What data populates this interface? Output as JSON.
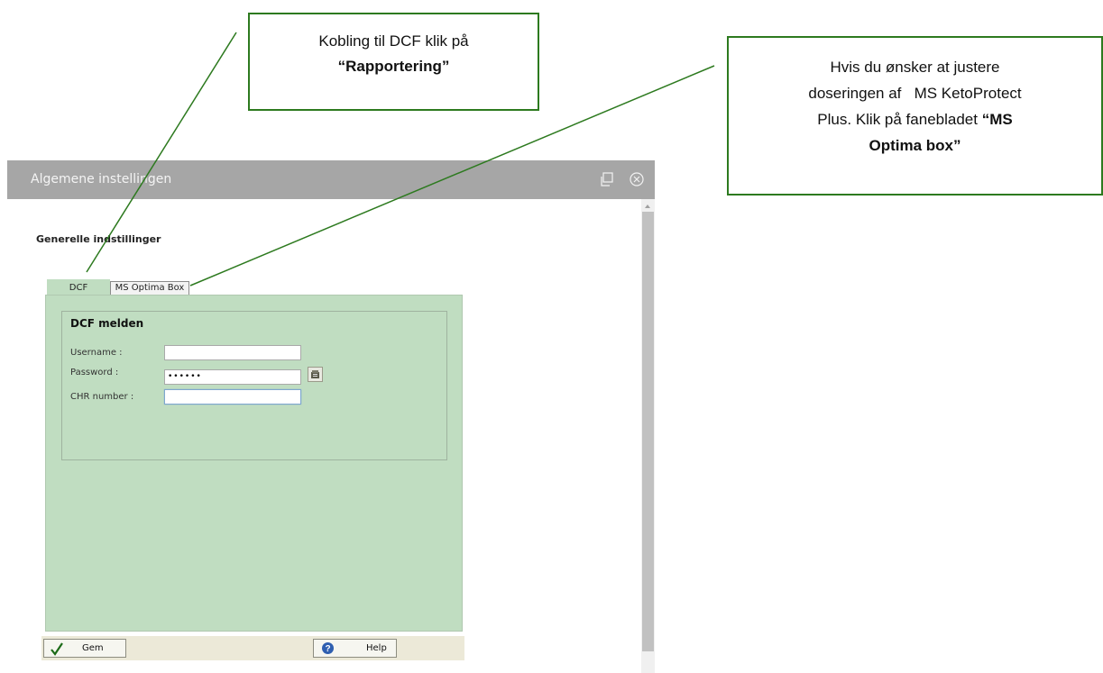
{
  "dialog": {
    "title": "Algemene instellingen",
    "heading": "Generelle indstillinger",
    "tabs": [
      {
        "label": "DCF",
        "active": true
      },
      {
        "label": "MS Optima Box",
        "active": false
      }
    ],
    "form": {
      "title": "DCF melden",
      "username_label": "Username :",
      "username_value": "",
      "password_label": "Password :",
      "password_value": "••••••",
      "chr_label": "CHR number :",
      "chr_value": ""
    },
    "footer": {
      "save_label": "Gem",
      "help_label": "Help"
    },
    "icons": [
      "restore-icon",
      "close-circle-icon",
      "password-keypad-icon",
      "checkmark-icon",
      "help-icon"
    ]
  },
  "callouts": {
    "first": {
      "line1": "Kobling til DCF klik på",
      "line2": "“Rapportering”"
    },
    "second": {
      "line1": "Hvis du ønsker at justere",
      "line2": "doseringen af   MS KetoProtect",
      "line3_plain": "Plus. Klik på fanebladet ",
      "line3_bold": "“MS",
      "line4": "Optima box”"
    }
  },
  "colors": {
    "panel_green": "#c0ddc1",
    "titlebar_gray": "#a6a6a6",
    "callout_border": "#2d7a1f"
  }
}
